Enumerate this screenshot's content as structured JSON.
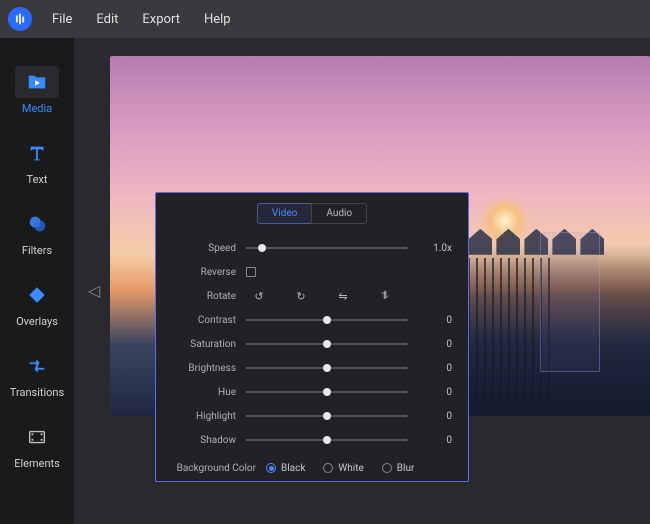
{
  "menubar": {
    "items": [
      "File",
      "Edit",
      "Export",
      "Help"
    ]
  },
  "sidebar": {
    "items": [
      {
        "label": "Media",
        "icon": "folder-play-icon",
        "active": true
      },
      {
        "label": "Text",
        "icon": "text-t-icon",
        "active": false
      },
      {
        "label": "Filters",
        "icon": "blob-icon",
        "active": false
      },
      {
        "label": "Overlays",
        "icon": "diamond-icon",
        "active": false
      },
      {
        "label": "Transitions",
        "icon": "arrows-h-icon",
        "active": false
      },
      {
        "label": "Elements",
        "icon": "filmstrip-icon",
        "active": false
      }
    ]
  },
  "panel": {
    "tabs": [
      {
        "label": "Video",
        "active": true
      },
      {
        "label": "Audio",
        "active": false
      }
    ],
    "speed": {
      "label": "Speed",
      "value": "1.0x",
      "pos": 0.1
    },
    "reverse": {
      "label": "Reverse",
      "checked": false
    },
    "rotate": {
      "label": "Rotate"
    },
    "contrast": {
      "label": "Contrast",
      "value": "0",
      "pos": 0.5
    },
    "saturation": {
      "label": "Saturation",
      "value": "0",
      "pos": 0.5
    },
    "brightness": {
      "label": "Brightness",
      "value": "0",
      "pos": 0.5
    },
    "hue": {
      "label": "Hue",
      "value": "0",
      "pos": 0.5
    },
    "highlight": {
      "label": "Highlight",
      "value": "0",
      "pos": 0.5
    },
    "shadow": {
      "label": "Shadow",
      "value": "0",
      "pos": 0.5
    },
    "bgcolor": {
      "label": "Background Color",
      "options": [
        "Black",
        "White",
        "Blur"
      ],
      "selected": "Black"
    }
  }
}
